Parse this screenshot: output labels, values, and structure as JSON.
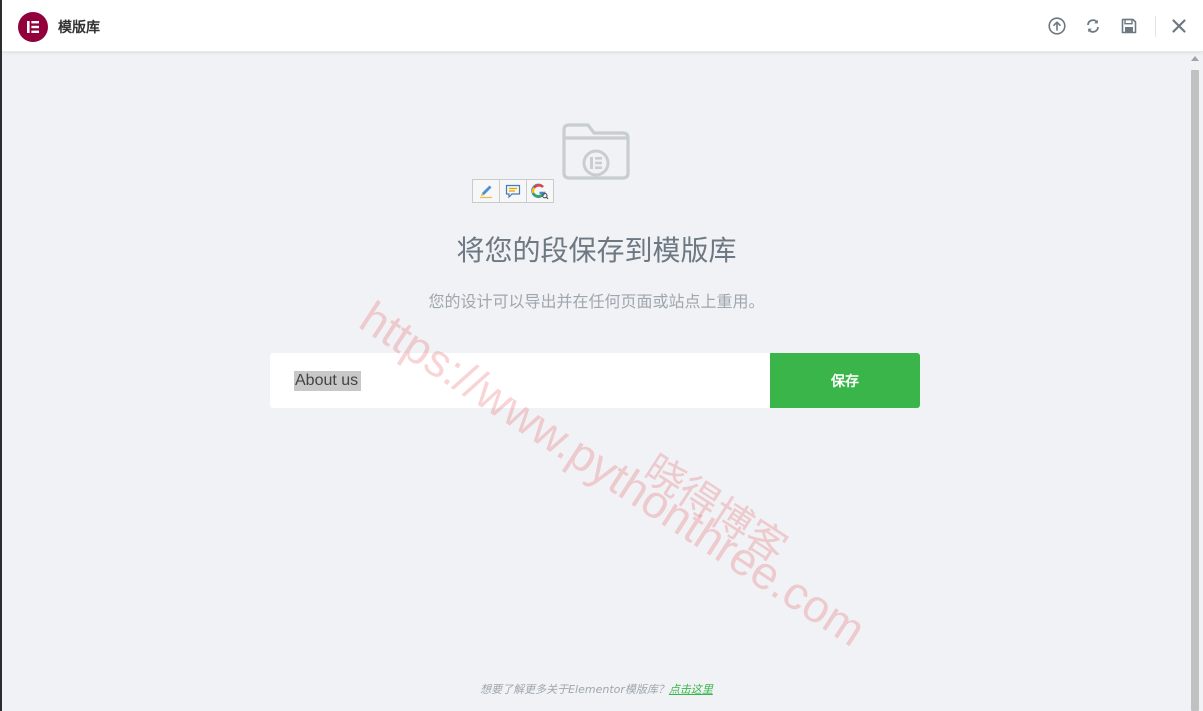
{
  "header": {
    "title": "模版库",
    "logo_icon": "elementor-logo-icon",
    "icons": [
      "upload-icon",
      "sync-icon",
      "save-icon",
      "close-icon"
    ]
  },
  "main": {
    "heading": "将您的段保存到模版库",
    "subheading": "您的设计可以导出并在任何页面或站点上重用。",
    "input_value": "About us",
    "save_label": "保存"
  },
  "extension_toolbar": {
    "icons": [
      "pencil-icon",
      "comment-icon",
      "google-search-icon"
    ]
  },
  "footer": {
    "text": "想要了解更多关于Elementor模版库？",
    "link": "点击这里"
  },
  "watermark": {
    "url": "https://www.pythonthree.com",
    "label": "晓得博客"
  },
  "colors": {
    "brand": "#92003b",
    "accent": "#39b54a",
    "background": "#f1f2f5"
  }
}
